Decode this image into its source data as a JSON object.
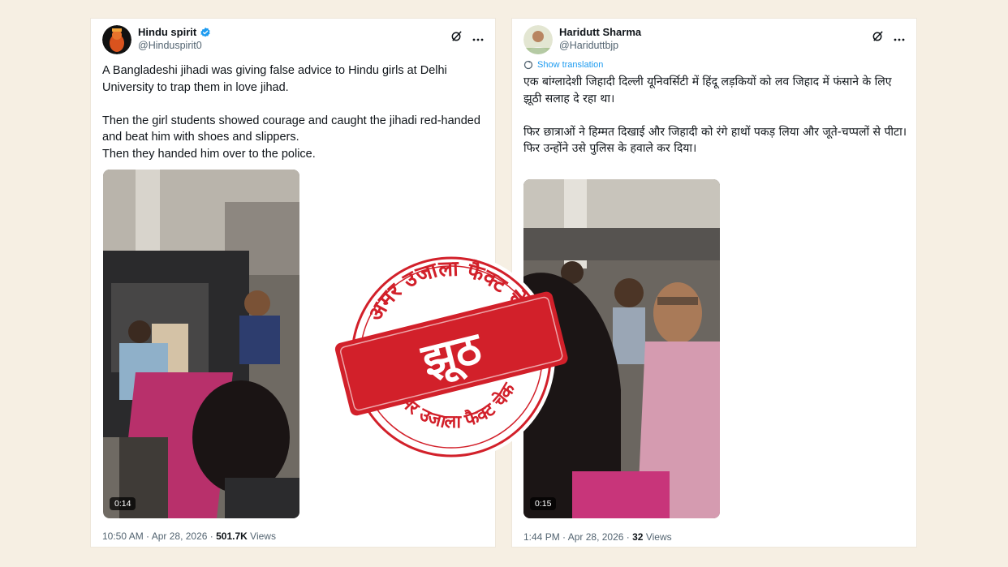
{
  "posts": [
    {
      "display_name": "Hindu spirit",
      "handle": "@Hinduspirit0",
      "body": "A Bangladeshi jihadi was giving false advice to Hindu girls at Delhi University to trap them in love jihad.\n\nThen the girl students showed courage and caught the jihadi red-handed and beat him with shoes and slippers.\nThen they handed him over to the police.",
      "video_duration": "0:14",
      "time": "10:50 AM",
      "date": "Apr 28, 2026",
      "views_count": "501.7K",
      "views_label": "Views"
    },
    {
      "display_name": "Haridutt Sharma",
      "handle": "@Hariduttbjp",
      "show_translation": "Show translation",
      "body": "एक बांग्लादेशी जिहादी दिल्ली यूनिवर्सिटी में हिंदू लड़कियों को लव जिहाद में फंसाने के लिए झूठी सलाह दे रहा था।\n\nफिर छात्राओं ने हिम्मत दिखाई और जिहादी को रंगे हाथों पकड़ लिया और जूते-चप्पलों से पीटा।\nफिर उन्होंने उसे पुलिस के हवाले कर दिया।",
      "video_duration": "0:15",
      "time": "1:44 PM",
      "date": "Apr 28, 2026",
      "views_count": "32",
      "views_label": "Views"
    }
  ],
  "stamp": {
    "top_arc": "अमर उजाला फैक्ट चेक",
    "bottom_arc": "अमर उजाला फैक्ट चेक",
    "verdict": "झूठ",
    "color": "#d2202a"
  },
  "icons": [
    "grok-icon",
    "more-icon",
    "verified-badge-icon",
    "translate-icon"
  ]
}
